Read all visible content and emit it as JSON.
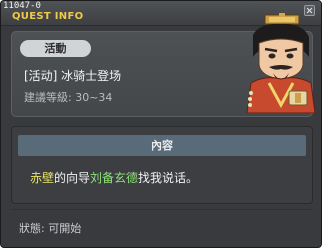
{
  "window": {
    "quest_id": "11047-0",
    "title": "QUEST INFO"
  },
  "quest": {
    "tag": "活動",
    "name": "[活动] 冰骑士登场",
    "level": "建議等級: 30~34"
  },
  "content": {
    "header": "內容",
    "line_place": "赤壁",
    "line_mid": "的向导",
    "line_npc": "刘备玄德",
    "line_end": "找我说话。"
  },
  "status": {
    "text": "狀態: 可開始"
  },
  "colors": {
    "title": "#f0c94a",
    "place_highlight": "#e8e46a",
    "npc_highlight": "#8fe27a",
    "content_header_bg": "#596a78"
  },
  "icons": {
    "close": "close-icon",
    "npc": "npc-portrait"
  }
}
